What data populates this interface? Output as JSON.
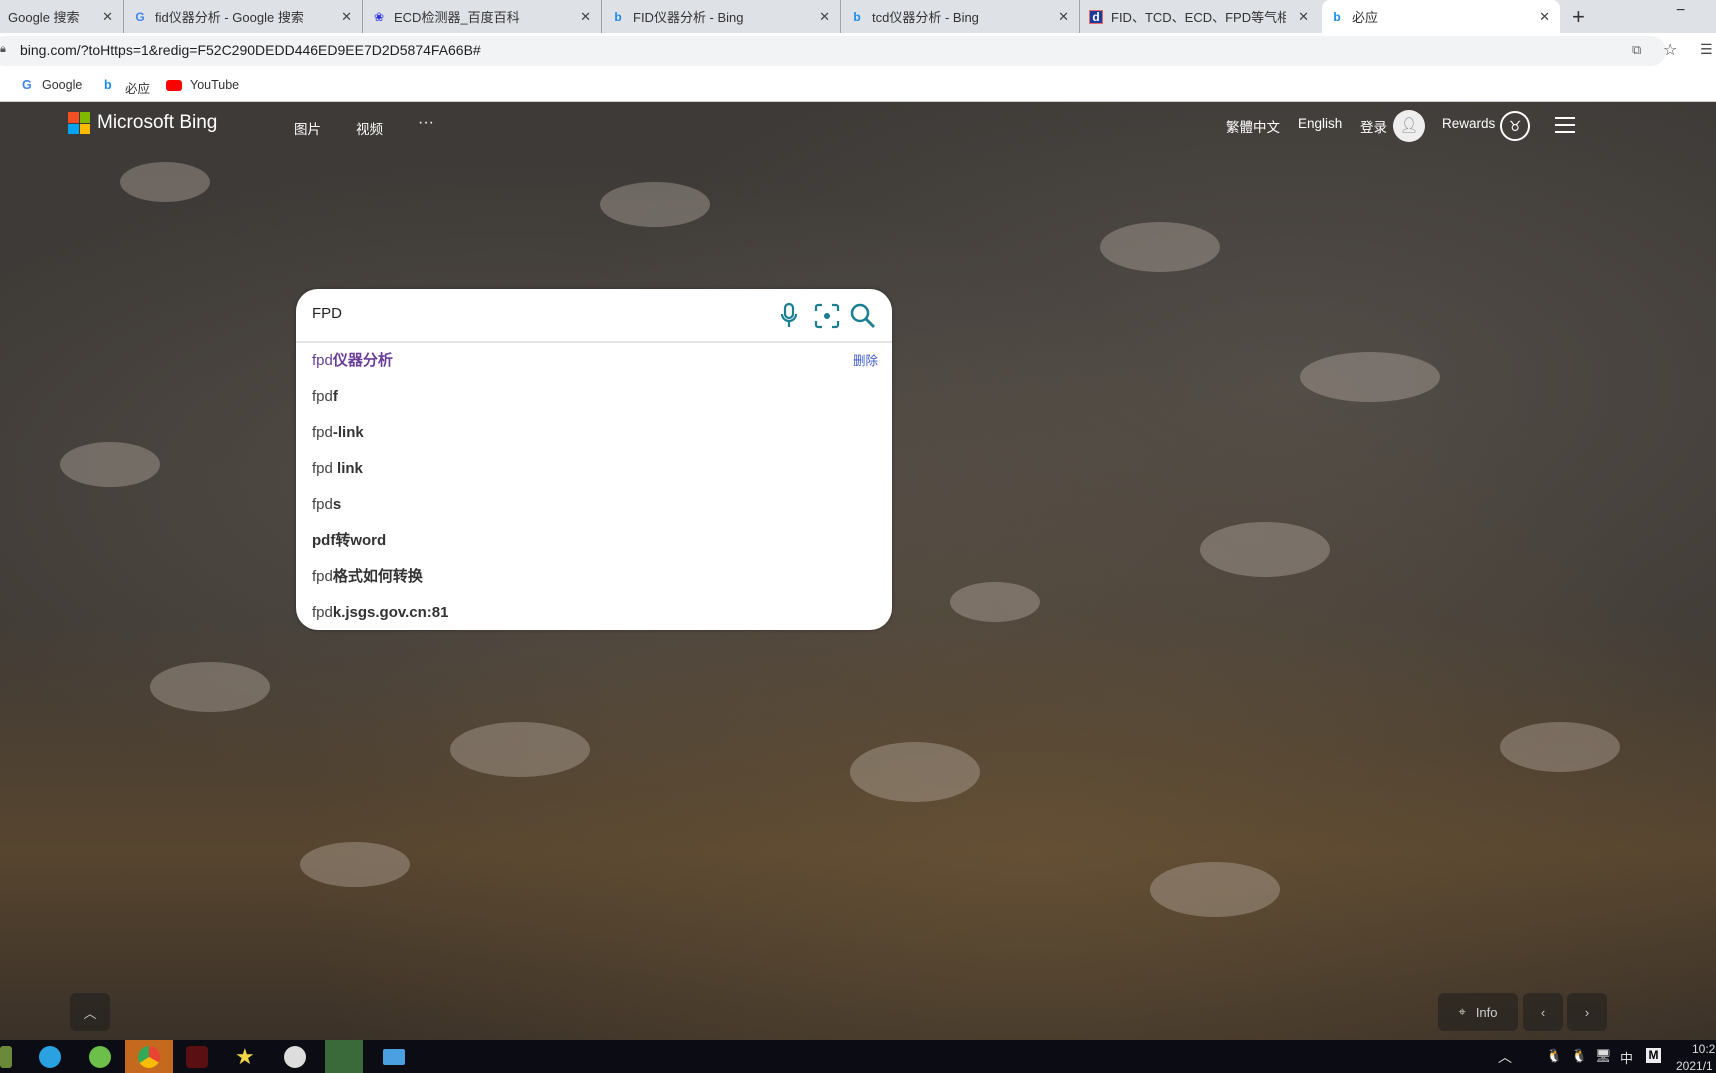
{
  "browser": {
    "tabs": [
      {
        "title": "Google 搜索",
        "icon": "google-icon"
      },
      {
        "title": "fid仪器分析 - Google 搜索",
        "icon": "google-icon"
      },
      {
        "title": "ECD检测器_百度百科",
        "icon": "baidu-icon"
      },
      {
        "title": "FID仪器分析 - Bing",
        "icon": "bing-icon"
      },
      {
        "title": "tcd仪器分析 - Bing",
        "icon": "bing-icon"
      },
      {
        "title": "FID、TCD、ECD、FPD等气相色",
        "icon": "doc88-icon"
      },
      {
        "title": "必应",
        "icon": "bing-icon",
        "active": true
      }
    ],
    "new_tab": "+",
    "minimize": "−",
    "url": "bing.com/?toHttps=1&redig=F52C290DEDD446ED9EE7D2D5874FA66B#",
    "bookmarks": [
      {
        "label": "Google",
        "icon": "google-icon"
      },
      {
        "label": "必应",
        "icon": "bing-icon"
      },
      {
        "label": "YouTube",
        "icon": "youtube-icon"
      }
    ]
  },
  "header": {
    "logo": "Microsoft Bing",
    "nav": [
      "图片",
      "视频",
      "···"
    ],
    "lang_trad": "繁體中文",
    "lang_en": "English",
    "login": "登录",
    "rewards": "Rewards"
  },
  "search": {
    "value": "FPD",
    "delete_label": "删除",
    "suggestions": [
      {
        "prefix": "fpd",
        "bold": "仪器分析",
        "history": true
      },
      {
        "prefix": "fpd",
        "bold": "f"
      },
      {
        "prefix": "fpd",
        "bold": "-link"
      },
      {
        "prefix": "fpd ",
        "bold": "link"
      },
      {
        "prefix": "fpd",
        "bold": "s"
      },
      {
        "prefix": "",
        "bold": "pdf转word"
      },
      {
        "prefix": "fpd",
        "bold": "格式如何转换"
      },
      {
        "prefix": "fpd",
        "bold": "k.jsgs.gov.cn:81"
      }
    ],
    "history_color": "#6a3e98",
    "accent": "#1b7f93"
  },
  "footer": {
    "info": "Info"
  },
  "taskbar": {
    "ime": "中",
    "clock": "10:2",
    "date": "2021/1"
  }
}
